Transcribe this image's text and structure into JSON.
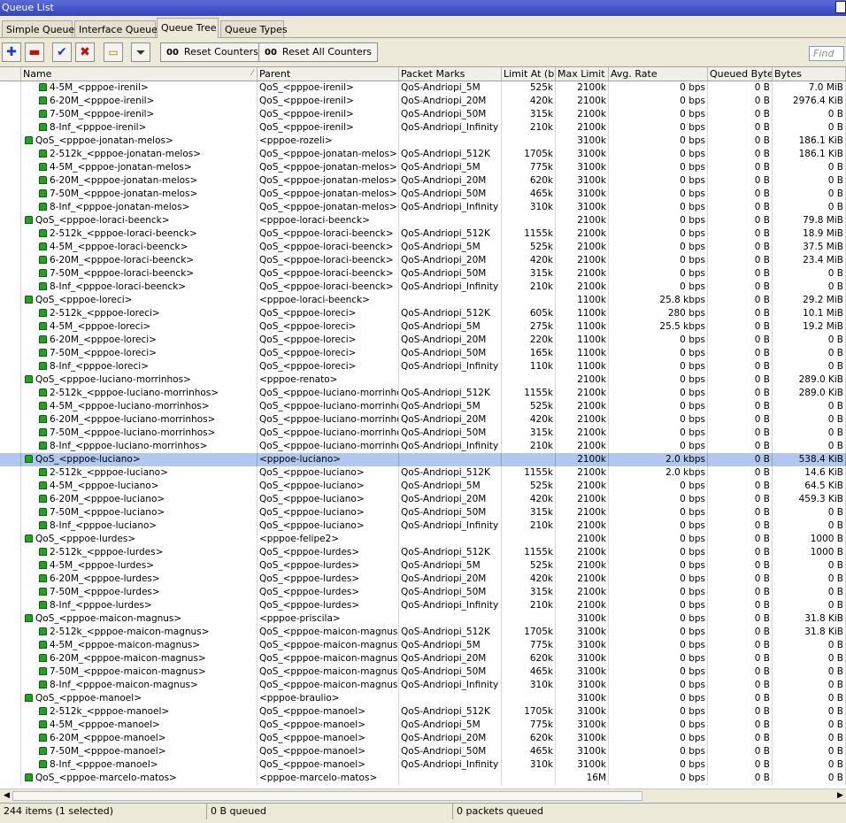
{
  "window": {
    "title": "Queue List"
  },
  "tabs": [
    "Simple Queues",
    "Interface Queues",
    "Queue Tree",
    "Queue Types"
  ],
  "active_tab": "Queue Tree",
  "toolbar": {
    "reset_counters": "Reset Counters",
    "reset_all_counters": "Reset All Counters",
    "find_placeholder": "Find"
  },
  "columns": [
    "Name",
    "Parent",
    "Packet Marks",
    "Limit At (b...",
    "Max Limit ...",
    "Avg. Rate",
    "Queued Bytes",
    "Bytes"
  ],
  "rows": [
    {
      "level": 2,
      "name": "4-5M_<pppoe-irenil>",
      "parent": "QoS_<pppoe-irenil>",
      "marks": "QoS-Andriopi_5M",
      "limit": "525k",
      "max": "2100k",
      "rate": "0 bps",
      "queued": "0 B",
      "bytes": "7.0 MiB"
    },
    {
      "level": 2,
      "name": "6-20M_<pppoe-irenil>",
      "parent": "QoS_<pppoe-irenil>",
      "marks": "QoS-Andriopi_20M",
      "limit": "420k",
      "max": "2100k",
      "rate": "0 bps",
      "queued": "0 B",
      "bytes": "2976.4 KiB"
    },
    {
      "level": 2,
      "name": "7-50M_<pppoe-irenil>",
      "parent": "QoS_<pppoe-irenil>",
      "marks": "QoS-Andriopi_50M",
      "limit": "315k",
      "max": "2100k",
      "rate": "0 bps",
      "queued": "0 B",
      "bytes": "0 B"
    },
    {
      "level": 2,
      "name": "8-Inf_<pppoe-irenil>",
      "parent": "QoS_<pppoe-irenil>",
      "marks": "QoS-Andriopi_Infinity",
      "limit": "210k",
      "max": "2100k",
      "rate": "0 bps",
      "queued": "0 B",
      "bytes": "0 B"
    },
    {
      "level": 1,
      "name": "QoS_<pppoe-jonatan-melos>",
      "parent": "<pppoe-rozeli>",
      "marks": "",
      "limit": "",
      "max": "3100k",
      "rate": "0 bps",
      "queued": "0 B",
      "bytes": "186.1 KiB"
    },
    {
      "level": 2,
      "name": "2-512k_<pppoe-jonatan-melos>",
      "parent": "QoS_<pppoe-jonatan-melos>",
      "marks": "QoS-Andriopi_512K",
      "limit": "1705k",
      "max": "3100k",
      "rate": "0 bps",
      "queued": "0 B",
      "bytes": "186.1 KiB"
    },
    {
      "level": 2,
      "name": "4-5M_<pppoe-jonatan-melos>",
      "parent": "QoS_<pppoe-jonatan-melos>",
      "marks": "QoS-Andriopi_5M",
      "limit": "775k",
      "max": "3100k",
      "rate": "0 bps",
      "queued": "0 B",
      "bytes": "0 B"
    },
    {
      "level": 2,
      "name": "6-20M_<pppoe-jonatan-melos>",
      "parent": "QoS_<pppoe-jonatan-melos>",
      "marks": "QoS-Andriopi_20M",
      "limit": "620k",
      "max": "3100k",
      "rate": "0 bps",
      "queued": "0 B",
      "bytes": "0 B"
    },
    {
      "level": 2,
      "name": "7-50M_<pppoe-jonatan-melos>",
      "parent": "QoS_<pppoe-jonatan-melos>",
      "marks": "QoS-Andriopi_50M",
      "limit": "465k",
      "max": "3100k",
      "rate": "0 bps",
      "queued": "0 B",
      "bytes": "0 B"
    },
    {
      "level": 2,
      "name": "8-Inf_<pppoe-jonatan-melos>",
      "parent": "QoS_<pppoe-jonatan-melos>",
      "marks": "QoS-Andriopi_Infinity",
      "limit": "310k",
      "max": "3100k",
      "rate": "0 bps",
      "queued": "0 B",
      "bytes": "0 B"
    },
    {
      "level": 1,
      "name": "QoS_<pppoe-loraci-beenck>",
      "parent": "<pppoe-loraci-beenck>",
      "marks": "",
      "limit": "",
      "max": "2100k",
      "rate": "0 bps",
      "queued": "0 B",
      "bytes": "79.8 MiB"
    },
    {
      "level": 2,
      "name": "2-512k_<pppoe-loraci-beenck>",
      "parent": "QoS_<pppoe-loraci-beenck>",
      "marks": "QoS-Andriopi_512K",
      "limit": "1155k",
      "max": "2100k",
      "rate": "0 bps",
      "queued": "0 B",
      "bytes": "18.9 MiB"
    },
    {
      "level": 2,
      "name": "4-5M_<pppoe-loraci-beenck>",
      "parent": "QoS_<pppoe-loraci-beenck>",
      "marks": "QoS-Andriopi_5M",
      "limit": "525k",
      "max": "2100k",
      "rate": "0 bps",
      "queued": "0 B",
      "bytes": "37.5 MiB"
    },
    {
      "level": 2,
      "name": "6-20M_<pppoe-loraci-beenck>",
      "parent": "QoS_<pppoe-loraci-beenck>",
      "marks": "QoS-Andriopi_20M",
      "limit": "420k",
      "max": "2100k",
      "rate": "0 bps",
      "queued": "0 B",
      "bytes": "23.4 MiB"
    },
    {
      "level": 2,
      "name": "7-50M_<pppoe-loraci-beenck>",
      "parent": "QoS_<pppoe-loraci-beenck>",
      "marks": "QoS-Andriopi_50M",
      "limit": "315k",
      "max": "2100k",
      "rate": "0 bps",
      "queued": "0 B",
      "bytes": "0 B"
    },
    {
      "level": 2,
      "name": "8-Inf_<pppoe-loraci-beenck>",
      "parent": "QoS_<pppoe-loraci-beenck>",
      "marks": "QoS-Andriopi_Infinity",
      "limit": "210k",
      "max": "2100k",
      "rate": "0 bps",
      "queued": "0 B",
      "bytes": "0 B"
    },
    {
      "level": 1,
      "name": "QoS_<pppoe-loreci>",
      "parent": "<pppoe-loraci-beenck>",
      "marks": "",
      "limit": "",
      "max": "1100k",
      "rate": "25.8 kbps",
      "queued": "0 B",
      "bytes": "29.2 MiB"
    },
    {
      "level": 2,
      "name": "2-512k_<pppoe-loreci>",
      "parent": "QoS_<pppoe-loreci>",
      "marks": "QoS-Andriopi_512K",
      "limit": "605k",
      "max": "1100k",
      "rate": "280 bps",
      "queued": "0 B",
      "bytes": "10.1 MiB"
    },
    {
      "level": 2,
      "name": "4-5M_<pppoe-loreci>",
      "parent": "QoS_<pppoe-loreci>",
      "marks": "QoS-Andriopi_5M",
      "limit": "275k",
      "max": "1100k",
      "rate": "25.5 kbps",
      "queued": "0 B",
      "bytes": "19.2 MiB"
    },
    {
      "level": 2,
      "name": "6-20M_<pppoe-loreci>",
      "parent": "QoS_<pppoe-loreci>",
      "marks": "QoS-Andriopi_20M",
      "limit": "220k",
      "max": "1100k",
      "rate": "0 bps",
      "queued": "0 B",
      "bytes": "0 B"
    },
    {
      "level": 2,
      "name": "7-50M_<pppoe-loreci>",
      "parent": "QoS_<pppoe-loreci>",
      "marks": "QoS-Andriopi_50M",
      "limit": "165k",
      "max": "1100k",
      "rate": "0 bps",
      "queued": "0 B",
      "bytes": "0 B"
    },
    {
      "level": 2,
      "name": "8-Inf_<pppoe-loreci>",
      "parent": "QoS_<pppoe-loreci>",
      "marks": "QoS-Andriopi_Infinity",
      "limit": "110k",
      "max": "1100k",
      "rate": "0 bps",
      "queued": "0 B",
      "bytes": "0 B"
    },
    {
      "level": 1,
      "name": "QoS_<pppoe-luciano-morrinhos>",
      "parent": "<pppoe-renato>",
      "marks": "",
      "limit": "",
      "max": "2100k",
      "rate": "0 bps",
      "queued": "0 B",
      "bytes": "289.0 KiB"
    },
    {
      "level": 2,
      "name": "2-512k_<pppoe-luciano-morrinhos>",
      "parent": "QoS_<pppoe-luciano-morrinhos>",
      "marks": "QoS-Andriopi_512K",
      "limit": "1155k",
      "max": "2100k",
      "rate": "0 bps",
      "queued": "0 B",
      "bytes": "289.0 KiB"
    },
    {
      "level": 2,
      "name": "4-5M_<pppoe-luciano-morrinhos>",
      "parent": "QoS_<pppoe-luciano-morrinhos>",
      "marks": "QoS-Andriopi_5M",
      "limit": "525k",
      "max": "2100k",
      "rate": "0 bps",
      "queued": "0 B",
      "bytes": "0 B"
    },
    {
      "level": 2,
      "name": "6-20M_<pppoe-luciano-morrinhos>",
      "parent": "QoS_<pppoe-luciano-morrinhos>",
      "marks": "QoS-Andriopi_20M",
      "limit": "420k",
      "max": "2100k",
      "rate": "0 bps",
      "queued": "0 B",
      "bytes": "0 B"
    },
    {
      "level": 2,
      "name": "7-50M_<pppoe-luciano-morrinhos>",
      "parent": "QoS_<pppoe-luciano-morrinhos>",
      "marks": "QoS-Andriopi_50M",
      "limit": "315k",
      "max": "2100k",
      "rate": "0 bps",
      "queued": "0 B",
      "bytes": "0 B"
    },
    {
      "level": 2,
      "name": "8-Inf_<pppoe-luciano-morrinhos>",
      "parent": "QoS_<pppoe-luciano-morrinhos>",
      "marks": "QoS-Andriopi_Infinity",
      "limit": "210k",
      "max": "2100k",
      "rate": "0 bps",
      "queued": "0 B",
      "bytes": "0 B"
    },
    {
      "level": 1,
      "name": "QoS_<pppoe-luciano>",
      "parent": "<pppoe-luciano>",
      "marks": "",
      "limit": "",
      "max": "2100k",
      "rate": "2.0 kbps",
      "queued": "0 B",
      "bytes": "538.4 KiB",
      "selected": true
    },
    {
      "level": 2,
      "name": "2-512k_<pppoe-luciano>",
      "parent": "QoS_<pppoe-luciano>",
      "marks": "QoS-Andriopi_512K",
      "limit": "1155k",
      "max": "2100k",
      "rate": "2.0 kbps",
      "queued": "0 B",
      "bytes": "14.6 KiB"
    },
    {
      "level": 2,
      "name": "4-5M_<pppoe-luciano>",
      "parent": "QoS_<pppoe-luciano>",
      "marks": "QoS-Andriopi_5M",
      "limit": "525k",
      "max": "2100k",
      "rate": "0 bps",
      "queued": "0 B",
      "bytes": "64.5 KiB"
    },
    {
      "level": 2,
      "name": "6-20M_<pppoe-luciano>",
      "parent": "QoS_<pppoe-luciano>",
      "marks": "QoS-Andriopi_20M",
      "limit": "420k",
      "max": "2100k",
      "rate": "0 bps",
      "queued": "0 B",
      "bytes": "459.3 KiB"
    },
    {
      "level": 2,
      "name": "7-50M_<pppoe-luciano>",
      "parent": "QoS_<pppoe-luciano>",
      "marks": "QoS-Andriopi_50M",
      "limit": "315k",
      "max": "2100k",
      "rate": "0 bps",
      "queued": "0 B",
      "bytes": "0 B"
    },
    {
      "level": 2,
      "name": "8-Inf_<pppoe-luciano>",
      "parent": "QoS_<pppoe-luciano>",
      "marks": "QoS-Andriopi_Infinity",
      "limit": "210k",
      "max": "2100k",
      "rate": "0 bps",
      "queued": "0 B",
      "bytes": "0 B"
    },
    {
      "level": 1,
      "name": "QoS_<pppoe-lurdes>",
      "parent": "<pppoe-felipe2>",
      "marks": "",
      "limit": "",
      "max": "2100k",
      "rate": "0 bps",
      "queued": "0 B",
      "bytes": "1000 B"
    },
    {
      "level": 2,
      "name": "2-512k_<pppoe-lurdes>",
      "parent": "QoS_<pppoe-lurdes>",
      "marks": "QoS-Andriopi_512K",
      "limit": "1155k",
      "max": "2100k",
      "rate": "0 bps",
      "queued": "0 B",
      "bytes": "1000 B"
    },
    {
      "level": 2,
      "name": "4-5M_<pppoe-lurdes>",
      "parent": "QoS_<pppoe-lurdes>",
      "marks": "QoS-Andriopi_5M",
      "limit": "525k",
      "max": "2100k",
      "rate": "0 bps",
      "queued": "0 B",
      "bytes": "0 B"
    },
    {
      "level": 2,
      "name": "6-20M_<pppoe-lurdes>",
      "parent": "QoS_<pppoe-lurdes>",
      "marks": "QoS-Andriopi_20M",
      "limit": "420k",
      "max": "2100k",
      "rate": "0 bps",
      "queued": "0 B",
      "bytes": "0 B"
    },
    {
      "level": 2,
      "name": "7-50M_<pppoe-lurdes>",
      "parent": "QoS_<pppoe-lurdes>",
      "marks": "QoS-Andriopi_50M",
      "limit": "315k",
      "max": "2100k",
      "rate": "0 bps",
      "queued": "0 B",
      "bytes": "0 B"
    },
    {
      "level": 2,
      "name": "8-Inf_<pppoe-lurdes>",
      "parent": "QoS_<pppoe-lurdes>",
      "marks": "QoS-Andriopi_Infinity",
      "limit": "210k",
      "max": "2100k",
      "rate": "0 bps",
      "queued": "0 B",
      "bytes": "0 B"
    },
    {
      "level": 1,
      "name": "QoS_<pppoe-maicon-magnus>",
      "parent": "<pppoe-priscila>",
      "marks": "",
      "limit": "",
      "max": "3100k",
      "rate": "0 bps",
      "queued": "0 B",
      "bytes": "31.8 KiB"
    },
    {
      "level": 2,
      "name": "2-512k_<pppoe-maicon-magnus>",
      "parent": "QoS_<pppoe-maicon-magnus>",
      "marks": "QoS-Andriopi_512K",
      "limit": "1705k",
      "max": "3100k",
      "rate": "0 bps",
      "queued": "0 B",
      "bytes": "31.8 KiB"
    },
    {
      "level": 2,
      "name": "4-5M_<pppoe-maicon-magnus>",
      "parent": "QoS_<pppoe-maicon-magnus>",
      "marks": "QoS-Andriopi_5M",
      "limit": "775k",
      "max": "3100k",
      "rate": "0 bps",
      "queued": "0 B",
      "bytes": "0 B"
    },
    {
      "level": 2,
      "name": "6-20M_<pppoe-maicon-magnus>",
      "parent": "QoS_<pppoe-maicon-magnus>",
      "marks": "QoS-Andriopi_20M",
      "limit": "620k",
      "max": "3100k",
      "rate": "0 bps",
      "queued": "0 B",
      "bytes": "0 B"
    },
    {
      "level": 2,
      "name": "7-50M_<pppoe-maicon-magnus>",
      "parent": "QoS_<pppoe-maicon-magnus>",
      "marks": "QoS-Andriopi_50M",
      "limit": "465k",
      "max": "3100k",
      "rate": "0 bps",
      "queued": "0 B",
      "bytes": "0 B"
    },
    {
      "level": 2,
      "name": "8-Inf_<pppoe-maicon-magnus>",
      "parent": "QoS_<pppoe-maicon-magnus>",
      "marks": "QoS-Andriopi_Infinity",
      "limit": "310k",
      "max": "3100k",
      "rate": "0 bps",
      "queued": "0 B",
      "bytes": "0 B"
    },
    {
      "level": 1,
      "name": "QoS_<pppoe-manoel>",
      "parent": "<pppoe-braulio>",
      "marks": "",
      "limit": "",
      "max": "3100k",
      "rate": "0 bps",
      "queued": "0 B",
      "bytes": "0 B"
    },
    {
      "level": 2,
      "name": "2-512k_<pppoe-manoel>",
      "parent": "QoS_<pppoe-manoel>",
      "marks": "QoS-Andriopi_512K",
      "limit": "1705k",
      "max": "3100k",
      "rate": "0 bps",
      "queued": "0 B",
      "bytes": "0 B"
    },
    {
      "level": 2,
      "name": "4-5M_<pppoe-manoel>",
      "parent": "QoS_<pppoe-manoel>",
      "marks": "QoS-Andriopi_5M",
      "limit": "775k",
      "max": "3100k",
      "rate": "0 bps",
      "queued": "0 B",
      "bytes": "0 B"
    },
    {
      "level": 2,
      "name": "6-20M_<pppoe-manoel>",
      "parent": "QoS_<pppoe-manoel>",
      "marks": "QoS-Andriopi_20M",
      "limit": "620k",
      "max": "3100k",
      "rate": "0 bps",
      "queued": "0 B",
      "bytes": "0 B"
    },
    {
      "level": 2,
      "name": "7-50M_<pppoe-manoel>",
      "parent": "QoS_<pppoe-manoel>",
      "marks": "QoS-Andriopi_50M",
      "limit": "465k",
      "max": "3100k",
      "rate": "0 bps",
      "queued": "0 B",
      "bytes": "0 B"
    },
    {
      "level": 2,
      "name": "8-Inf_<pppoe-manoel>",
      "parent": "QoS_<pppoe-manoel>",
      "marks": "QoS-Andriopi_Infinity",
      "limit": "310k",
      "max": "3100k",
      "rate": "0 bps",
      "queued": "0 B",
      "bytes": "0 B"
    },
    {
      "level": 1,
      "name": "QoS_<pppoe-marcelo-matos>",
      "parent": "<pppoe-marcelo-matos>",
      "marks": "",
      "limit": "",
      "max": "16M",
      "rate": "0 bps",
      "queued": "0 B",
      "bytes": "0 B"
    }
  ],
  "status": {
    "items": "244 items (1 selected)",
    "queued": "0 B queued",
    "packets": "0 packets queued"
  },
  "colors": {
    "titlebar": "#3344c0",
    "selection": "#b0c8ee",
    "queue_icon": "#21a321"
  }
}
